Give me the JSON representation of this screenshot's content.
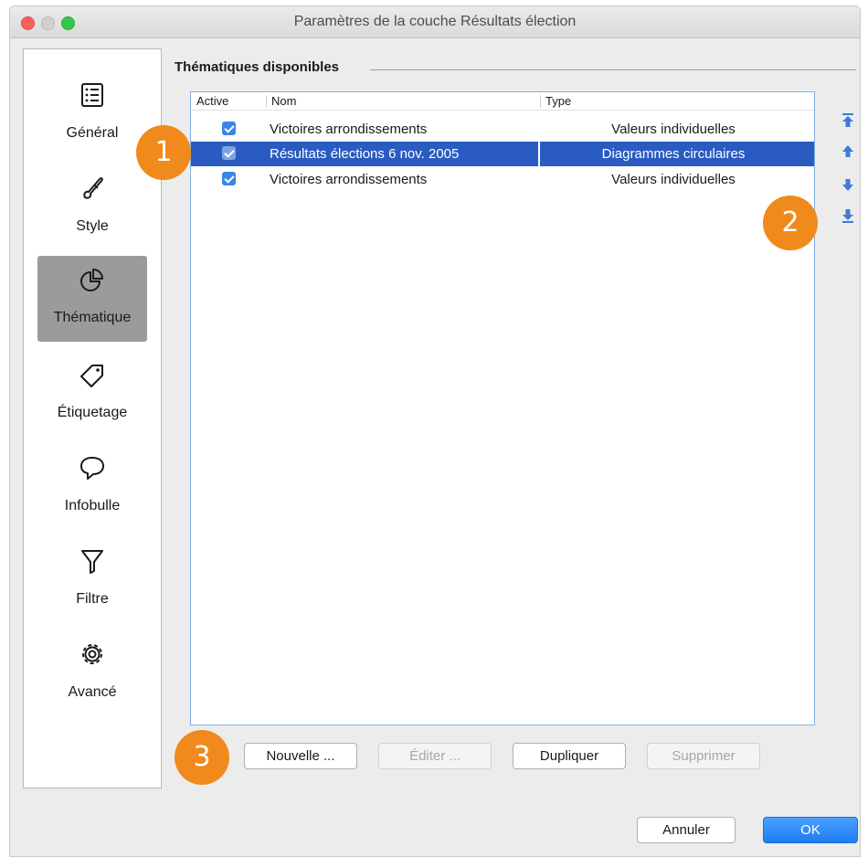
{
  "window": {
    "title": "Paramètres de la couche Résultats élection"
  },
  "sidebar": {
    "items": [
      {
        "label": "Général",
        "icon": "list-icon",
        "selected": false
      },
      {
        "label": "Style",
        "icon": "brush-icon",
        "selected": false
      },
      {
        "label": "Thématique",
        "icon": "pie-chart-icon",
        "selected": true
      },
      {
        "label": "Étiquetage",
        "icon": "tag-icon",
        "selected": false
      },
      {
        "label": "Infobulle",
        "icon": "speech-bubble-icon",
        "selected": false
      },
      {
        "label": "Filtre",
        "icon": "funnel-icon",
        "selected": false
      },
      {
        "label": "Avancé",
        "icon": "gear-icon",
        "selected": false
      }
    ]
  },
  "themes": {
    "group_title": "Thématiques disponibles",
    "columns": [
      "Active",
      "Nom",
      "Type"
    ],
    "rows": [
      {
        "active": true,
        "name": "Victoires arrondissements",
        "type": "Valeurs individuelles",
        "selected": false
      },
      {
        "active": true,
        "name": "Résultats élections 6 nov. 2005",
        "type": "Diagrammes circulaires",
        "selected": true
      },
      {
        "active": true,
        "name": "Victoires arrondissements",
        "type": "Valeurs individuelles",
        "selected": false
      }
    ]
  },
  "order_controls": [
    "move-to-top-icon",
    "move-up-icon",
    "move-down-icon",
    "move-to-bottom-icon"
  ],
  "actions": {
    "new_label": "Nouvelle ...",
    "edit_label": "Éditer ...",
    "duplicate_label": "Dupliquer",
    "delete_label": "Supprimer"
  },
  "dialog": {
    "cancel_label": "Annuler",
    "ok_label": "OK"
  },
  "callouts": [
    "1",
    "2",
    "3"
  ],
  "colors": {
    "accent": "#2a5bc0",
    "callout": "#f08a1c",
    "checkbox": "#3a86e8",
    "ok_button": "#1f7cf3"
  }
}
